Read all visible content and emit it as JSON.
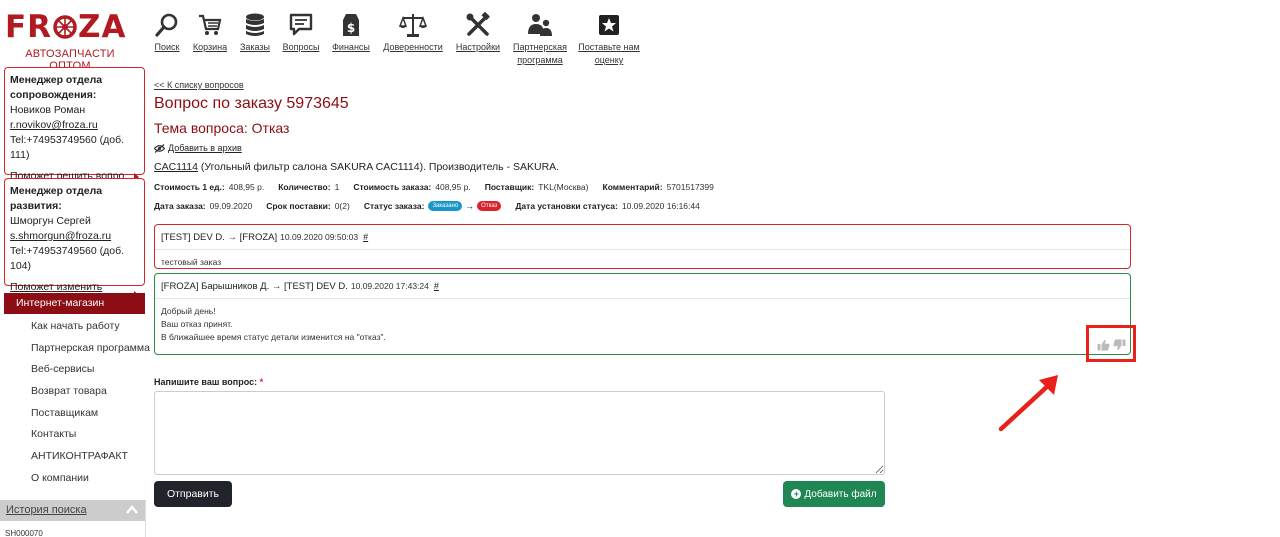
{
  "logo": {
    "word_left": "FR",
    "word_right": "ZA",
    "subtitle": "АВТОЗАПЧАСТИ ОПТОМ"
  },
  "nav": [
    {
      "label": "Поиск",
      "icon": "search-icon"
    },
    {
      "label": "Корзина",
      "icon": "cart-icon"
    },
    {
      "label": "Заказы",
      "icon": "database-icon"
    },
    {
      "label": "Вопросы",
      "icon": "chat-icon"
    },
    {
      "label": "Финансы",
      "icon": "money-bag-icon"
    },
    {
      "label": "Доверенности",
      "icon": "scales-icon"
    },
    {
      "label": "Настройки",
      "icon": "tools-icon"
    },
    {
      "label_line1": "Партнерская",
      "label_line2": "программа",
      "icon": "partners-icon"
    },
    {
      "label_line1": "Поставьте нам",
      "label_line2": "оценку",
      "icon": "star-icon"
    }
  ],
  "managers": [
    {
      "title_line1": "Менеджер отдела",
      "title_line2": "сопровождения:",
      "name": "Новиков Роман",
      "email": "r.novikov@froza.ru",
      "phone": "Tel:+74953749560 (доб. 111)",
      "help": "Поможет решить вопро..."
    },
    {
      "title_line1": "Менеджер отдела",
      "title_line2": "развития:",
      "name": "Шморгун Сергей",
      "email": "s.shmorgun@froza.ru",
      "phone": "Tel:+74953749560 (доб. 104)",
      "help": "Поможет изменить усло..."
    }
  ],
  "menu": {
    "head": "Интернет-магазин",
    "items": [
      "Как начать работу",
      "Партнерская программа",
      "Веб-сервисы",
      "Возврат товара",
      "Поставщикам",
      "Контакты",
      "АНТИКОНТРАФАКТ",
      "О компании"
    ]
  },
  "history": {
    "label": "История поиска",
    "first_item": "SH000070"
  },
  "question": {
    "back_link": "<< К списку вопросов",
    "title": "Вопрос по заказу 5973645",
    "topic": "Тема вопроса: Отказ",
    "archive": "Добавить в архив",
    "part_code": "CAC1114",
    "part_desc": " (Угольный фильтр салона SAKURA CAC1114). Производитель - SAKURA."
  },
  "info1": {
    "unit_price_label": "Стоимость 1 ед.:",
    "unit_price": "408,95 р.",
    "qty_label": "Количество:",
    "qty": "1",
    "order_cost_label": "Стоимость заказа:",
    "order_cost": "408,95 р.",
    "supplier_label": "Поставщик:",
    "supplier": "TKL(Москва)",
    "comment_label": "Комментарий:",
    "comment": "5701517399"
  },
  "info2": {
    "order_date_label": "Дата заказа:",
    "order_date": "09.09.2020",
    "delivery_label": "Срок поставки:",
    "delivery": "0(2)",
    "status_label": "Статус заказа:",
    "status_from": "Заказано",
    "status_arrow": "→",
    "status_to": "Отказ",
    "status_date_label": "Дата установки статуса:",
    "status_date": "10.09.2020 16:16:44"
  },
  "messages": [
    {
      "from": "[TEST] DEV D. → [FROZA]",
      "date": "10.09.2020 09:50:03",
      "hash": "#",
      "lines": [
        "тестовый заказ"
      ]
    },
    {
      "from": "[FROZA] Барышников Д. → [TEST] DEV D.",
      "date": "10.09.2020 17:43:24",
      "hash": "#",
      "lines": [
        "Добрый день!",
        "Ваш отказ принят.",
        "В ближайшее время статус детали изменится на \"отказ\"."
      ]
    }
  ],
  "form": {
    "label": "Напишите ваш вопрос:",
    "required_mark": " *",
    "send": "Отправить",
    "add_file": "Добавить файл",
    "add_file_icon": "plus-circle-icon"
  },
  "colors": {
    "brand_red": "#b01b22",
    "dark_red": "#8c0e14",
    "green": "#1e8753",
    "highlight": "#e8211b"
  }
}
